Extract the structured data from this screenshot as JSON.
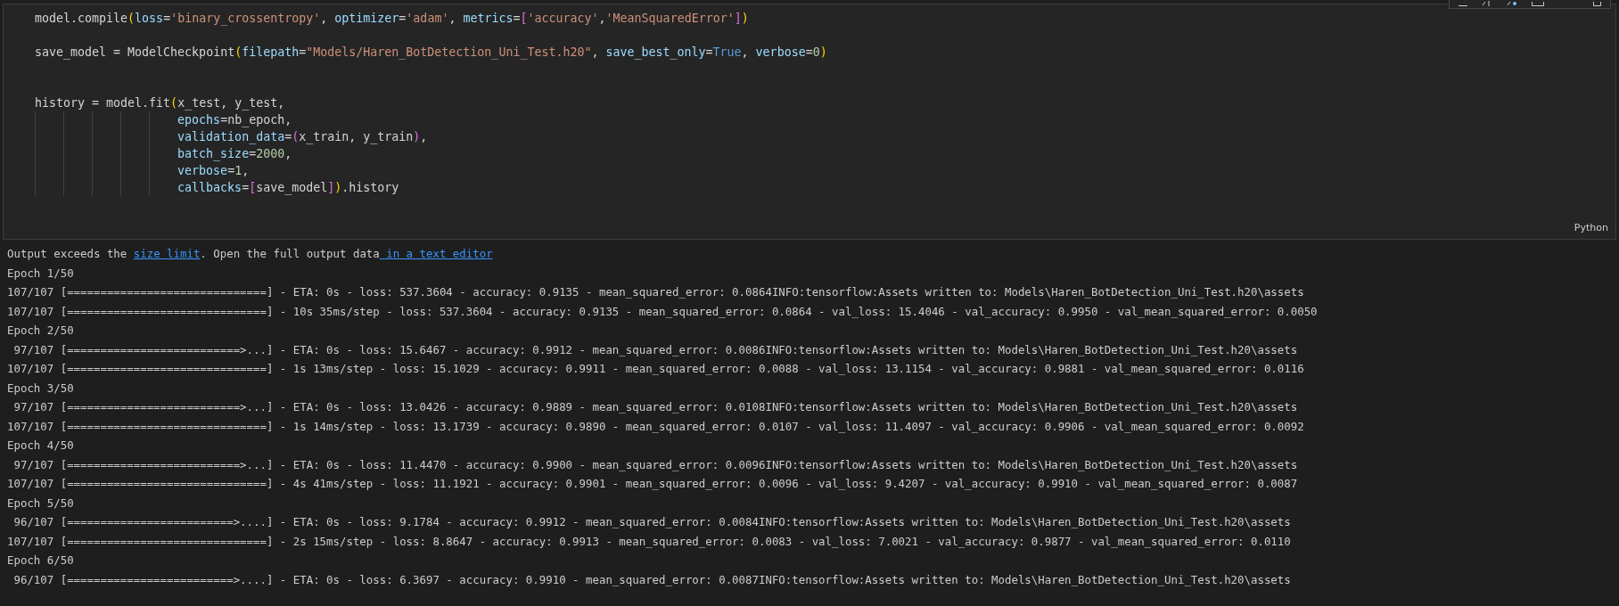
{
  "cell": {
    "language": "Python",
    "code_lines": [
      {
        "kind": "code",
        "tokens": [
          {
            "kind": "plain",
            "text": "model.compile"
          },
          {
            "kind": "bracket1",
            "text": "("
          },
          {
            "kind": "param",
            "text": "loss"
          },
          {
            "kind": "plain",
            "text": "="
          },
          {
            "kind": "string",
            "text": "'binary_crossentropy'"
          },
          {
            "kind": "plain",
            "text": ", "
          },
          {
            "kind": "param",
            "text": "optimizer"
          },
          {
            "kind": "plain",
            "text": "="
          },
          {
            "kind": "string",
            "text": "'adam'"
          },
          {
            "kind": "plain",
            "text": ", "
          },
          {
            "kind": "param",
            "text": "metrics"
          },
          {
            "kind": "plain",
            "text": "="
          },
          {
            "kind": "bracket2",
            "text": "["
          },
          {
            "kind": "string",
            "text": "'accuracy'"
          },
          {
            "kind": "plain",
            "text": ","
          },
          {
            "kind": "string",
            "text": "'MeanSquaredError'"
          },
          {
            "kind": "bracket2",
            "text": "]"
          },
          {
            "kind": "bracket1",
            "text": ")"
          }
        ]
      },
      {
        "kind": "blank"
      },
      {
        "kind": "code",
        "tokens": [
          {
            "kind": "plain",
            "text": "save_model = ModelCheckpoint"
          },
          {
            "kind": "bracket1",
            "text": "("
          },
          {
            "kind": "param",
            "text": "filepath"
          },
          {
            "kind": "plain",
            "text": "="
          },
          {
            "kind": "string",
            "text": "\"Models/Haren_BotDetection_Uni_Test.h20\""
          },
          {
            "kind": "plain",
            "text": ", "
          },
          {
            "kind": "param",
            "text": "save_best_only"
          },
          {
            "kind": "plain",
            "text": "="
          },
          {
            "kind": "constant",
            "text": "True"
          },
          {
            "kind": "plain",
            "text": ", "
          },
          {
            "kind": "param",
            "text": "verbose"
          },
          {
            "kind": "plain",
            "text": "="
          },
          {
            "kind": "number",
            "text": "0"
          },
          {
            "kind": "bracket1",
            "text": ")"
          }
        ]
      },
      {
        "kind": "blank"
      },
      {
        "kind": "blank"
      },
      {
        "kind": "code",
        "tokens": [
          {
            "kind": "plain",
            "text": "history = model.fit"
          },
          {
            "kind": "bracket1",
            "text": "("
          },
          {
            "kind": "plain",
            "text": "x_test, y_test,"
          }
        ]
      },
      {
        "kind": "continuation",
        "tokens": [
          {
            "kind": "param",
            "text": "epochs"
          },
          {
            "kind": "plain",
            "text": "=nb_epoch,"
          }
        ]
      },
      {
        "kind": "continuation",
        "tokens": [
          {
            "kind": "param",
            "text": "validation_data"
          },
          {
            "kind": "plain",
            "text": "="
          },
          {
            "kind": "bracket2",
            "text": "("
          },
          {
            "kind": "plain",
            "text": "x_train, y_train"
          },
          {
            "kind": "bracket2",
            "text": ")"
          },
          {
            "kind": "plain",
            "text": ","
          }
        ]
      },
      {
        "kind": "continuation",
        "tokens": [
          {
            "kind": "param",
            "text": "batch_size"
          },
          {
            "kind": "plain",
            "text": "="
          },
          {
            "kind": "number",
            "text": "2000"
          },
          {
            "kind": "plain",
            "text": ","
          }
        ]
      },
      {
        "kind": "continuation",
        "tokens": [
          {
            "kind": "param",
            "text": "verbose"
          },
          {
            "kind": "plain",
            "text": "="
          },
          {
            "kind": "number",
            "text": "1"
          },
          {
            "kind": "plain",
            "text": ","
          }
        ]
      },
      {
        "kind": "continuation",
        "tokens": [
          {
            "kind": "param",
            "text": "callbacks"
          },
          {
            "kind": "plain",
            "text": "="
          },
          {
            "kind": "bracket2",
            "text": "["
          },
          {
            "kind": "plain",
            "text": "save_model"
          },
          {
            "kind": "bracket2",
            "text": "]"
          },
          {
            "kind": "bracket1",
            "text": ")"
          },
          {
            "kind": "plain",
            "text": ".history"
          }
        ]
      }
    ]
  },
  "output": {
    "notice": [
      {
        "kind": "text",
        "text": "Output exceeds the "
      },
      {
        "kind": "link",
        "text": "size limit"
      },
      {
        "kind": "text",
        "text": ". Open the full output data"
      },
      {
        "kind": "link",
        "text": " in a text editor"
      }
    ],
    "lines": [
      "Epoch 1/50",
      "107/107 [==============================] - ETA: 0s - loss: 537.3604 - accuracy: 0.9135 - mean_squared_error: 0.0864INFO:tensorflow:Assets written to: Models\\Haren_BotDetection_Uni_Test.h20\\assets",
      "107/107 [==============================] - 10s 35ms/step - loss: 537.3604 - accuracy: 0.9135 - mean_squared_error: 0.0864 - val_loss: 15.4046 - val_accuracy: 0.9950 - val_mean_squared_error: 0.0050",
      "Epoch 2/50",
      " 97/107 [==========================>...] - ETA: 0s - loss: 15.6467 - accuracy: 0.9912 - mean_squared_error: 0.0086INFO:tensorflow:Assets written to: Models\\Haren_BotDetection_Uni_Test.h20\\assets",
      "107/107 [==============================] - 1s 13ms/step - loss: 15.1029 - accuracy: 0.9911 - mean_squared_error: 0.0088 - val_loss: 13.1154 - val_accuracy: 0.9881 - val_mean_squared_error: 0.0116",
      "Epoch 3/50",
      " 97/107 [==========================>...] - ETA: 0s - loss: 13.0426 - accuracy: 0.9889 - mean_squared_error: 0.0108INFO:tensorflow:Assets written to: Models\\Haren_BotDetection_Uni_Test.h20\\assets",
      "107/107 [==============================] - 1s 14ms/step - loss: 13.1739 - accuracy: 0.9890 - mean_squared_error: 0.0107 - val_loss: 11.4097 - val_accuracy: 0.9906 - val_mean_squared_error: 0.0092",
      "Epoch 4/50",
      " 97/107 [==========================>...] - ETA: 0s - loss: 11.4470 - accuracy: 0.9900 - mean_squared_error: 0.0096INFO:tensorflow:Assets written to: Models\\Haren_BotDetection_Uni_Test.h20\\assets",
      "107/107 [==============================] - 4s 41ms/step - loss: 11.1921 - accuracy: 0.9901 - mean_squared_error: 0.0096 - val_loss: 9.4207 - val_accuracy: 0.9910 - val_mean_squared_error: 0.0087",
      "Epoch 5/50",
      " 96/107 [=========================>....] - ETA: 0s - loss: 9.1784 - accuracy: 0.9912 - mean_squared_error: 0.0084INFO:tensorflow:Assets written to: Models\\Haren_BotDetection_Uni_Test.h20\\assets",
      "107/107 [==============================] - 2s 15ms/step - loss: 8.8647 - accuracy: 0.9913 - mean_squared_error: 0.0083 - val_loss: 7.0021 - val_accuracy: 0.9877 - val_mean_squared_error: 0.0110",
      "Epoch 6/50",
      " 96/107 [=========================>....] - ETA: 0s - loss: 6.3697 - accuracy: 0.9910 - mean_squared_error: 0.0087INFO:tensorflow:Assets written to: Models\\Haren_BotDetection_Uni_Test.h20\\assets"
    ]
  }
}
